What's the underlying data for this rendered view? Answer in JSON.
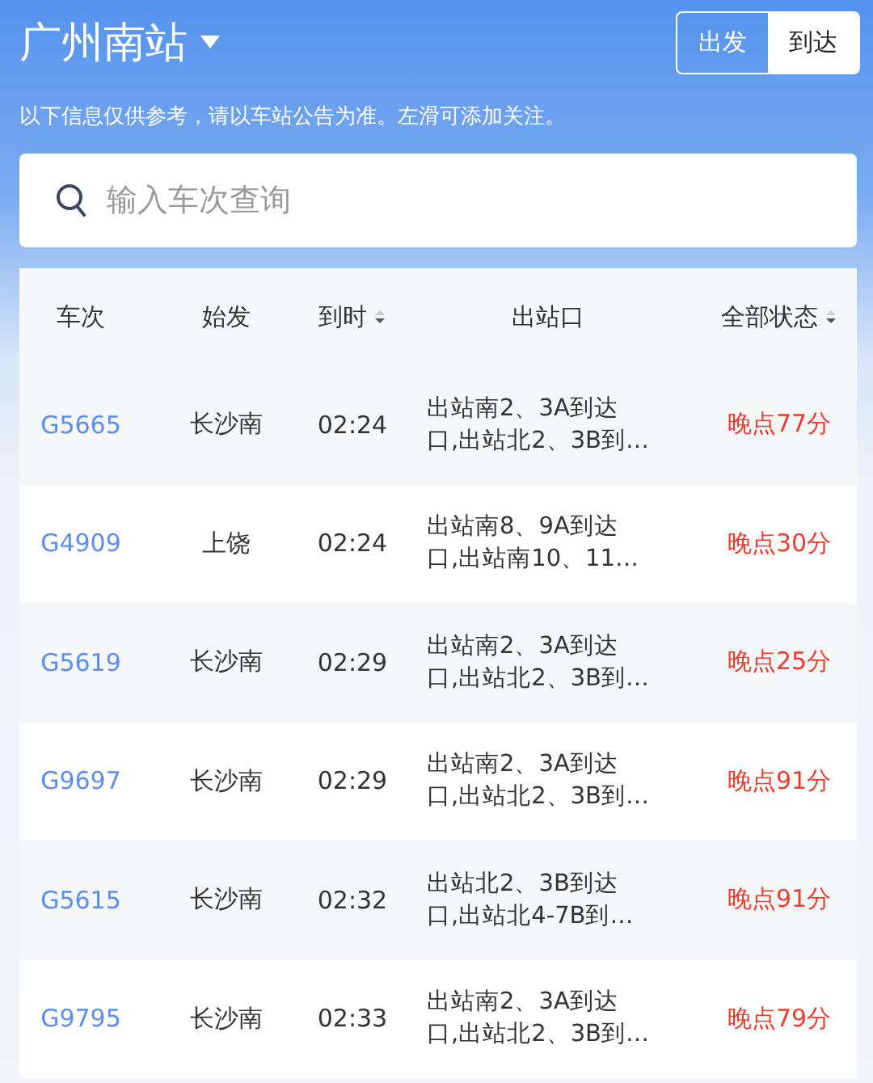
{
  "header": {
    "station": "广州南站",
    "modes": [
      {
        "label": "出发",
        "selected": false
      },
      {
        "label": "到达",
        "selected": true
      }
    ]
  },
  "notice": "以下信息仅供参考，请以车站公告为准。左滑可添加关注。",
  "search": {
    "placeholder": "输入车次查询"
  },
  "table": {
    "columns": [
      {
        "label": "车次",
        "sortable": false
      },
      {
        "label": "始发",
        "sortable": false
      },
      {
        "label": "到时",
        "sortable": true
      },
      {
        "label": "出站口",
        "sortable": false
      },
      {
        "label": "全部状态",
        "sortable": true
      }
    ],
    "rows": [
      {
        "train": "G5665",
        "origin": "长沙南",
        "time": "02:24",
        "exit": [
          "出站南2、3A到达",
          "口,出站北2、3B到…"
        ],
        "status": "晚点77分"
      },
      {
        "train": "G4909",
        "origin": "上饶",
        "time": "02:24",
        "exit": [
          "出站南8、9A到达",
          "口,出站南10、11…"
        ],
        "status": "晚点30分"
      },
      {
        "train": "G5619",
        "origin": "长沙南",
        "time": "02:29",
        "exit": [
          "出站南2、3A到达",
          "口,出站北2、3B到…"
        ],
        "status": "晚点25分"
      },
      {
        "train": "G9697",
        "origin": "长沙南",
        "time": "02:29",
        "exit": [
          "出站南2、3A到达",
          "口,出站北2、3B到…"
        ],
        "status": "晚点91分"
      },
      {
        "train": "G5615",
        "origin": "长沙南",
        "time": "02:32",
        "exit": [
          "出站北2、3B到达",
          "口,出站北4-7B到…"
        ],
        "status": "晚点91分"
      },
      {
        "train": "G9795",
        "origin": "长沙南",
        "time": "02:33",
        "exit": [
          "出站南2、3A到达",
          "口,出站北2、3B到…"
        ],
        "status": "晚点79分"
      }
    ]
  }
}
